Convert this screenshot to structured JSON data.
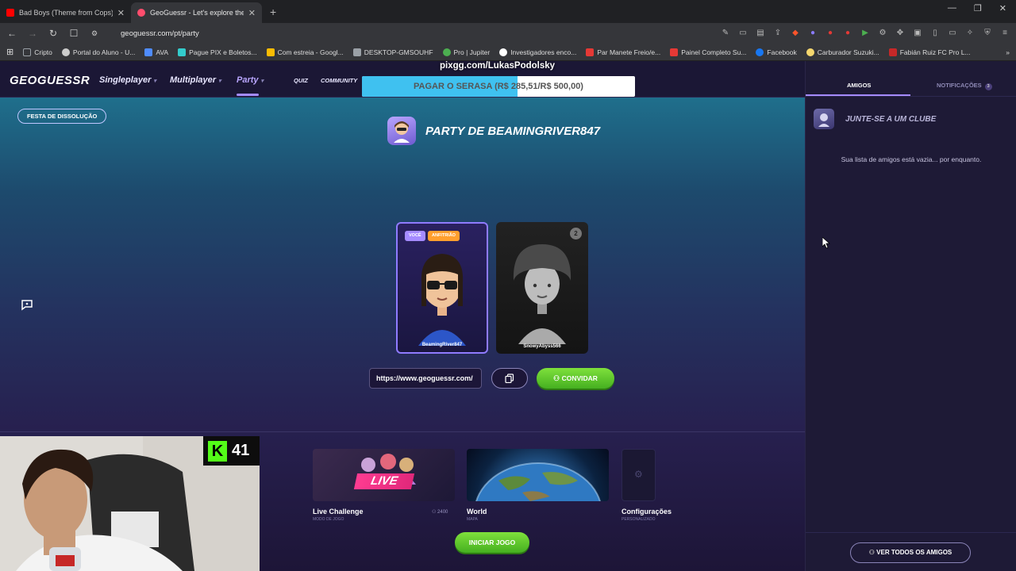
{
  "browser": {
    "tabs": [
      {
        "title": "Bad Boys (Theme from Cops) - YouTu",
        "active": false,
        "favicon_color": "#ff0000"
      },
      {
        "title": "GeoGuessr - Let's explore the w",
        "active": true,
        "favicon_color": "#ff4d6d"
      }
    ],
    "url": "geoguessr.com/pt/party",
    "bookmarks": [
      {
        "label": "Cripto",
        "color": "#9aa0a6"
      },
      {
        "label": "Portal do Aluno - U...",
        "color": "#cccccc"
      },
      {
        "label": "AVA",
        "color": "#4f8cff"
      },
      {
        "label": "Pague PIX e Boletos...",
        "color": "#3cc"
      },
      {
        "label": "Com estreia - Googl...",
        "color": "#fbbc04"
      },
      {
        "label": "DESKTOP-GMSOUHF",
        "color": "#9aa0a6"
      },
      {
        "label": "Pro | Jupiter",
        "color": "#4caf50"
      },
      {
        "label": "Investigadores enco...",
        "color": "#ffffff"
      },
      {
        "label": "Par Manete Freio/e...",
        "color": "#e53935"
      },
      {
        "label": "Painel Completo Su...",
        "color": "#e53935"
      },
      {
        "label": "Facebook",
        "color": "#1877f2"
      },
      {
        "label": "Carburador Suzuki...",
        "color": "#f5d76e"
      },
      {
        "label": "Fabián Ruiz FC Pro L...",
        "color": "#c62828"
      }
    ]
  },
  "overlay": {
    "pix_text": "pixgg.com/LukasPodolsky",
    "donation_text": "PAGAR O SERASA (R$ 285,51/R$ 500,00)",
    "donation_progress": 0.571
  },
  "header": {
    "logo": "GEOGUESSR",
    "nav": {
      "singleplayer": "Singleplayer",
      "multiplayer": "Multiplayer",
      "party": "Party",
      "quiz": "QUIZ",
      "community": "COMMUNITY"
    }
  },
  "party": {
    "festa_button": "FESTA DE DISSOLUÇÃO",
    "title": "PARTY DE BEAMINGRIVER847",
    "members": [
      {
        "name": "BeamingRiver847",
        "badge_you": "VOCÊ",
        "badge_host": "ANFITRIÃO"
      },
      {
        "name": "SnowyAbyss566",
        "slot": "2"
      }
    ],
    "invite_link": "https://www.geoguessr.com/",
    "invite_button": "CONVIDAR"
  },
  "modes": [
    {
      "label": "Live Challenge",
      "sub": "MODO DE JOGO",
      "players": "2400",
      "tag": "LIVE"
    },
    {
      "label": "World",
      "sub": "MAPA"
    },
    {
      "label": "Configurações",
      "sub": "PERSONALIZADO"
    }
  ],
  "start_button": "INICIAR JOGO",
  "stream": {
    "viewer_count": "41",
    "platform_letter": "K"
  },
  "sidebar": {
    "tab_friends": "AMIGOS",
    "tab_notifications": "NOTIFICAÇÕES",
    "notifications_count": "3",
    "club_text": "JUNTE-SE A UM CLUBE",
    "empty_text": "Sua lista de amigos está vazia... por enquanto.",
    "all_friends_button": "VER TODOS OS AMIGOS"
  },
  "colors": {
    "accent_purple": "#a58bff",
    "accent_green": "#45b020",
    "donation_blue": "#3fc1f0"
  }
}
